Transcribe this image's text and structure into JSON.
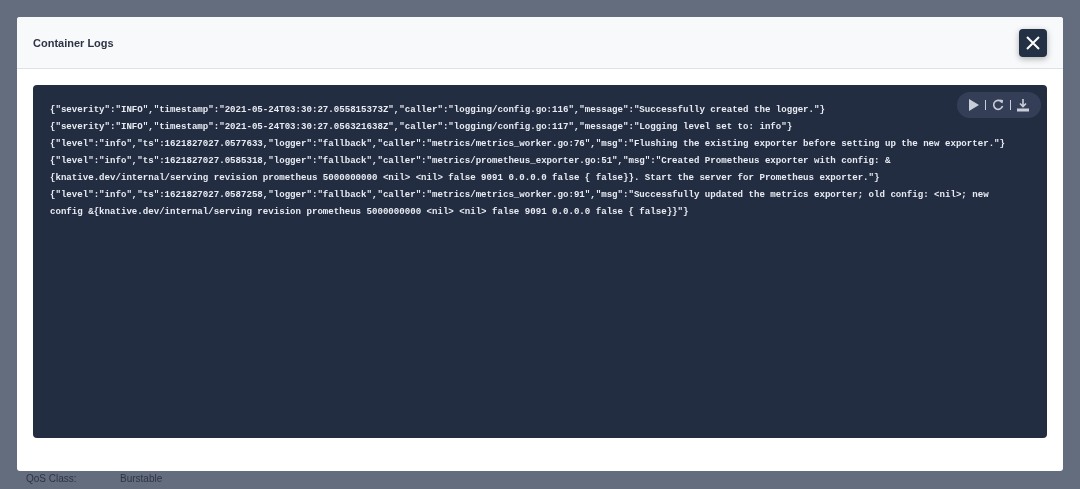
{
  "modal": {
    "title": "Container Logs"
  },
  "log_lines": [
    "{\"severity\":\"INFO\",\"timestamp\":\"2021-05-24T03:30:27.055815373Z\",\"caller\":\"logging/config.go:116\",\"message\":\"Successfully created the logger.\"}",
    "{\"severity\":\"INFO\",\"timestamp\":\"2021-05-24T03:30:27.056321638Z\",\"caller\":\"logging/config.go:117\",\"message\":\"Logging level set to: info\"}",
    "{\"level\":\"info\",\"ts\":1621827027.0577633,\"logger\":\"fallback\",\"caller\":\"metrics/metrics_worker.go:76\",\"msg\":\"Flushing the existing exporter before setting up the new exporter.\"}",
    "{\"level\":\"info\",\"ts\":1621827027.0585318,\"logger\":\"fallback\",\"caller\":\"metrics/prometheus_exporter.go:51\",\"msg\":\"Created Prometheus exporter with config: &",
    "{knative.dev/internal/serving revision prometheus 5000000000 <nil> <nil> false 9091 0.0.0.0 false { false}}. Start the server for Prometheus exporter.\"}",
    "{\"level\":\"info\",\"ts\":1621827027.0587258,\"logger\":\"fallback\",\"caller\":\"metrics/metrics_worker.go:91\",\"msg\":\"Successfully updated the metrics exporter; old config: <nil>; new",
    "config &{knative.dev/internal/serving revision prometheus 5000000000 <nil> <nil> false 9091 0.0.0.0 false { false}}\"}"
  ],
  "background": {
    "fields": [
      {
        "label": "QoS Class:",
        "value": "Burstable"
      }
    ]
  }
}
